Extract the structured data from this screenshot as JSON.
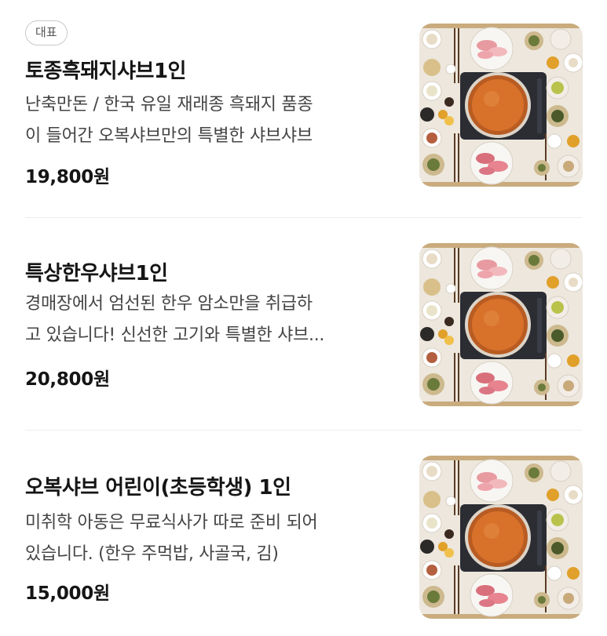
{
  "menu": {
    "items": [
      {
        "badge": "대표",
        "name": "토종흑돼지샤브1인",
        "description_lines": [
          "난축만돈 / 한국 유일 재래종 흑돼지 품종",
          "이 들어간 오복샤브만의 특별한 샤브샤브"
        ],
        "price": "19,800원",
        "image_icon": "shabu-hotpot-photo"
      },
      {
        "name": "특상한우샤브1인",
        "description_lines": [
          "경매장에서 엄선된 한우 암소만을 취급하",
          "고 있습니다! 신선한 고기와 특별한 샤브..."
        ],
        "price": "20,800원",
        "image_icon": "shabu-hotpot-photo"
      },
      {
        "name": "오복샤브 어린이(초등학생) 1인",
        "description_lines": [
          "미취학 아동은 무료식사가 따로 준비 되어",
          "있습니다. (한우 주먹밥, 사골국, 김)"
        ],
        "price": "15,000원",
        "image_icon": "shabu-hotpot-photo"
      }
    ]
  },
  "colors": {
    "text": "#151515",
    "secondary_text": "#444444",
    "badge_border": "#c9c9c9",
    "divider": "#ececec",
    "broth": "#d46a1f",
    "pot": "#2b2d33",
    "meat": "#e78b93",
    "table": "#ece6dc"
  }
}
